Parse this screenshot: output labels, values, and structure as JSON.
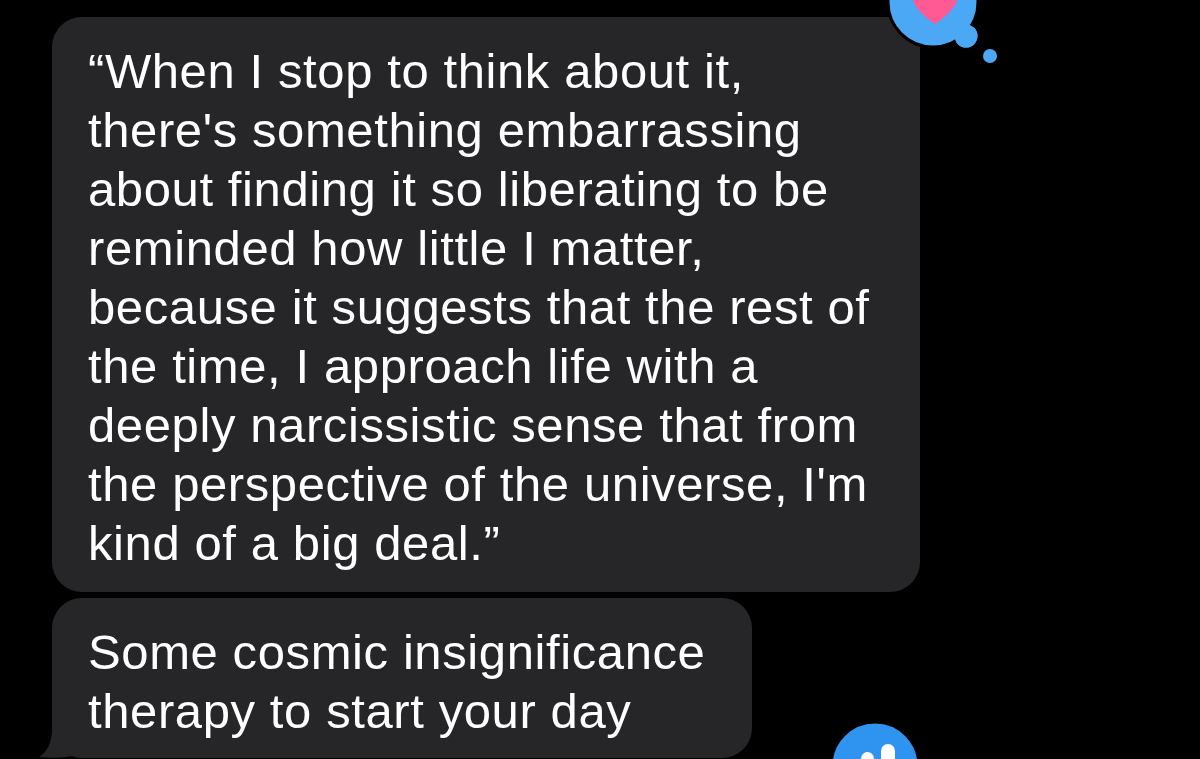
{
  "messages": [
    {
      "text": "“When I stop to think about it, there's something embarrassing about finding it so liberating to be reminded how little I matter, because it suggests that the rest of the time, I approach life with a deeply narcissistic sense that from the perspective of the universe, I'm kind of a big deal.”",
      "tail": false
    },
    {
      "text": "Some cosmic insignificance therapy to start your day",
      "tail": true
    }
  ]
}
